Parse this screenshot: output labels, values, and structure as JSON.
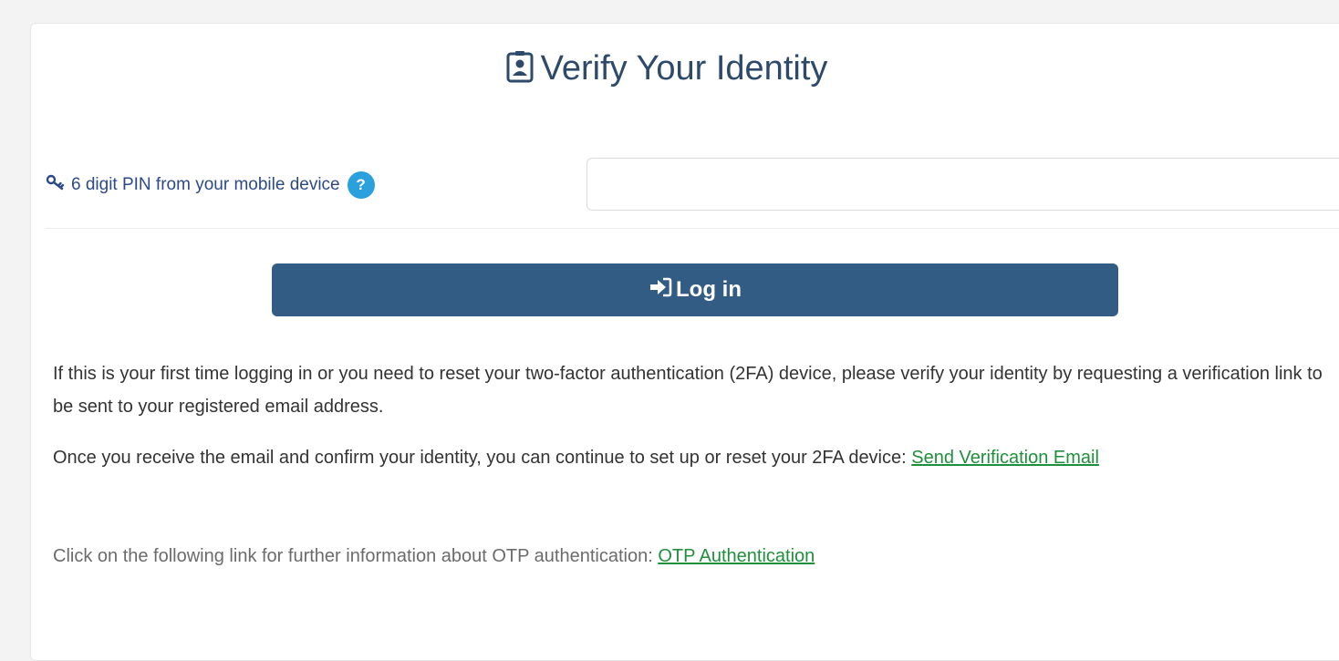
{
  "header": {
    "title": "Verify Your Identity",
    "title_icon": "id-badge-icon"
  },
  "pin": {
    "label": "6 digit PIN from your mobile device",
    "label_icon": "key-icon",
    "help_icon": "question-circle-icon",
    "help_glyph": "?",
    "input_value": ""
  },
  "login": {
    "label": "Log in",
    "icon": "sign-in-icon"
  },
  "info": {
    "paragraph1": "If this is your first time logging in or you need to reset your two-factor authentication (2FA) device, please verify your identity by requesting a verification link to be sent to your registered email address.",
    "paragraph2_text": "Once you receive the email and confirm your identity, you can continue to set up or reset your 2FA device: ",
    "paragraph2_link": "Send Verification Email",
    "paragraph3_text": "Click on the following link for further information about OTP authentication: ",
    "paragraph3_link": "OTP Authentication"
  },
  "colors": {
    "title": "#2d4a6b",
    "label": "#2c4a8a",
    "button": "#335c85",
    "help": "#2aa0dc",
    "link": "#1e8f3a"
  }
}
